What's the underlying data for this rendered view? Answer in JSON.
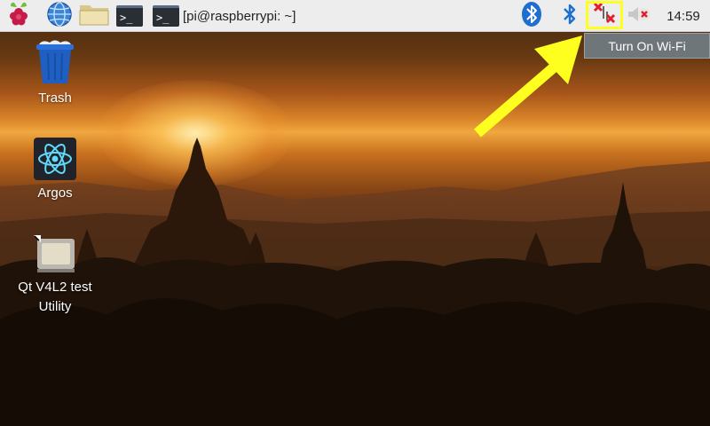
{
  "taskbar": {
    "menu_icon": "raspberry-pi-logo-icon",
    "browser_icon": "globe-icon",
    "files_icon": "folder-icon",
    "terminal_icon": "terminal-icon",
    "terminal_prompt": ">_",
    "terminal_window_label": "[pi@raspberrypi: ~]",
    "bluetooth_icon": "bluetooth-icon",
    "wifi_icon": "wifi-disconnected-icon",
    "volume_icon": "volume-muted-icon",
    "clock": "14:59"
  },
  "tooltip": {
    "text": "Turn On Wi-Fi"
  },
  "desktop": {
    "icons": [
      {
        "label": "Trash",
        "icon": "trash-icon"
      },
      {
        "label": "Argos",
        "icon": "atom-icon"
      },
      {
        "label": "Qt V4L2 test Utility",
        "icon": "webcam-icon"
      }
    ]
  },
  "annotation": {
    "highlight_color": "#ffff1f",
    "arrow_icon": "arrow-icon"
  },
  "colors": {
    "taskbar_bg": "#ededed",
    "bluetooth_blue": "#1f6fd0",
    "error_red": "#e0202a",
    "tooltip_bg": "#6f767a"
  }
}
